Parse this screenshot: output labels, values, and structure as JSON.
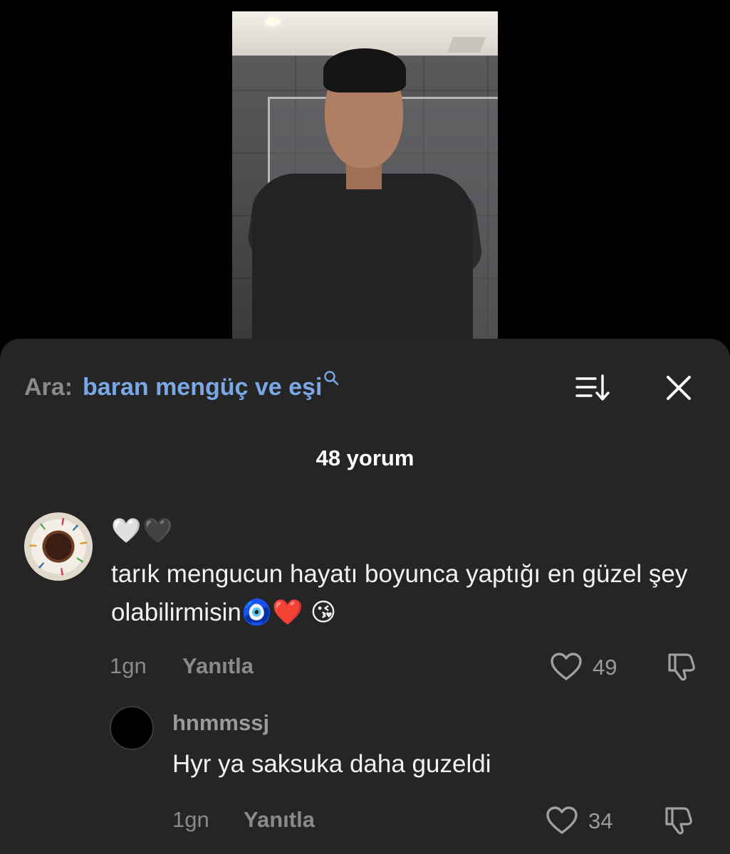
{
  "search": {
    "prefix": "Ara:",
    "query": "baran mengüç ve eşi",
    "icon": "search-icon"
  },
  "header": {
    "sort_icon": "sort-icon",
    "close_icon": "close-icon"
  },
  "comments_count": "48 yorum",
  "comments": [
    {
      "username": "🤍🖤",
      "text": "tarık mengucun hayatı boyunca yaptığı en güzel şey olabilirmisin🧿❤️ 😘",
      "time": "1gn",
      "reply_label": "Yanıtla",
      "likes": "49"
    },
    {
      "username": "hnmmssj",
      "text": "Hyr ya saksuka daha guzeldi",
      "time": "1gn",
      "reply_label": "Yanıtla",
      "likes": "34"
    }
  ],
  "colors": {
    "sheet_bg": "#252525",
    "search_query": "#7aa8e6",
    "muted": "#8a8a8a"
  }
}
